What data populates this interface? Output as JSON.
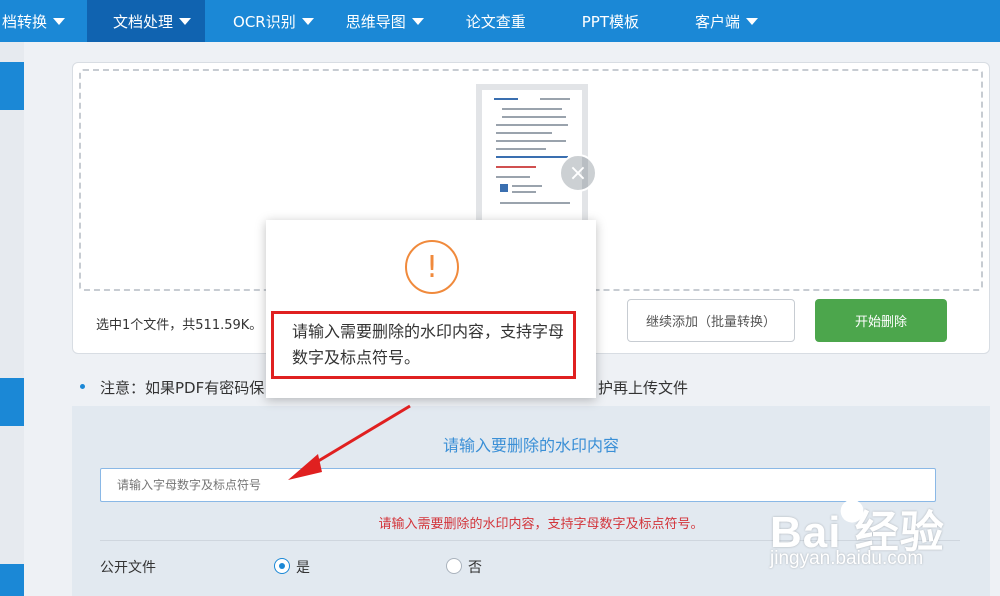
{
  "nav": {
    "items": [
      {
        "label": "档转换",
        "has_caret": true
      },
      {
        "label": "文档处理",
        "has_caret": true,
        "active": true
      },
      {
        "label": "OCR识别",
        "has_caret": true
      },
      {
        "label": "思维导图",
        "has_caret": true
      },
      {
        "label": "论文查重",
        "has_caret": false
      },
      {
        "label": "PPT模板",
        "has_caret": false
      },
      {
        "label": "客户端",
        "has_caret": true
      }
    ]
  },
  "upload": {
    "file_status": "选中1个文件，共511.59K。",
    "continue_button": "继续添加（批量转换）",
    "start_button": "开始删除",
    "remove_icon": "×"
  },
  "notice": {
    "text": "注意：如果PDF有密码保",
    "tail": "护再上传文件"
  },
  "watermark": {
    "title": "请输入要删除的水印内容",
    "input_placeholder": "请输入字母数字及标点符号",
    "error": "请输入需要删除的水印内容，支持字母数字及标点符号。"
  },
  "public_file": {
    "label": "公开文件",
    "options": [
      {
        "label": "是",
        "checked": true
      },
      {
        "label": "否",
        "checked": false
      }
    ]
  },
  "modal": {
    "icon": "!",
    "message": "请输入需要删除的水印内容，支持字母数字及标点符号。"
  },
  "brand": {
    "logo_text": "Bai 经验",
    "logo_sub": "jingyan.baidu.com"
  },
  "colors": {
    "primary": "#1b88d6",
    "success": "#4ca64c",
    "error": "#d3343a",
    "warning": "#f08a3c",
    "annotation": "#e02020"
  }
}
